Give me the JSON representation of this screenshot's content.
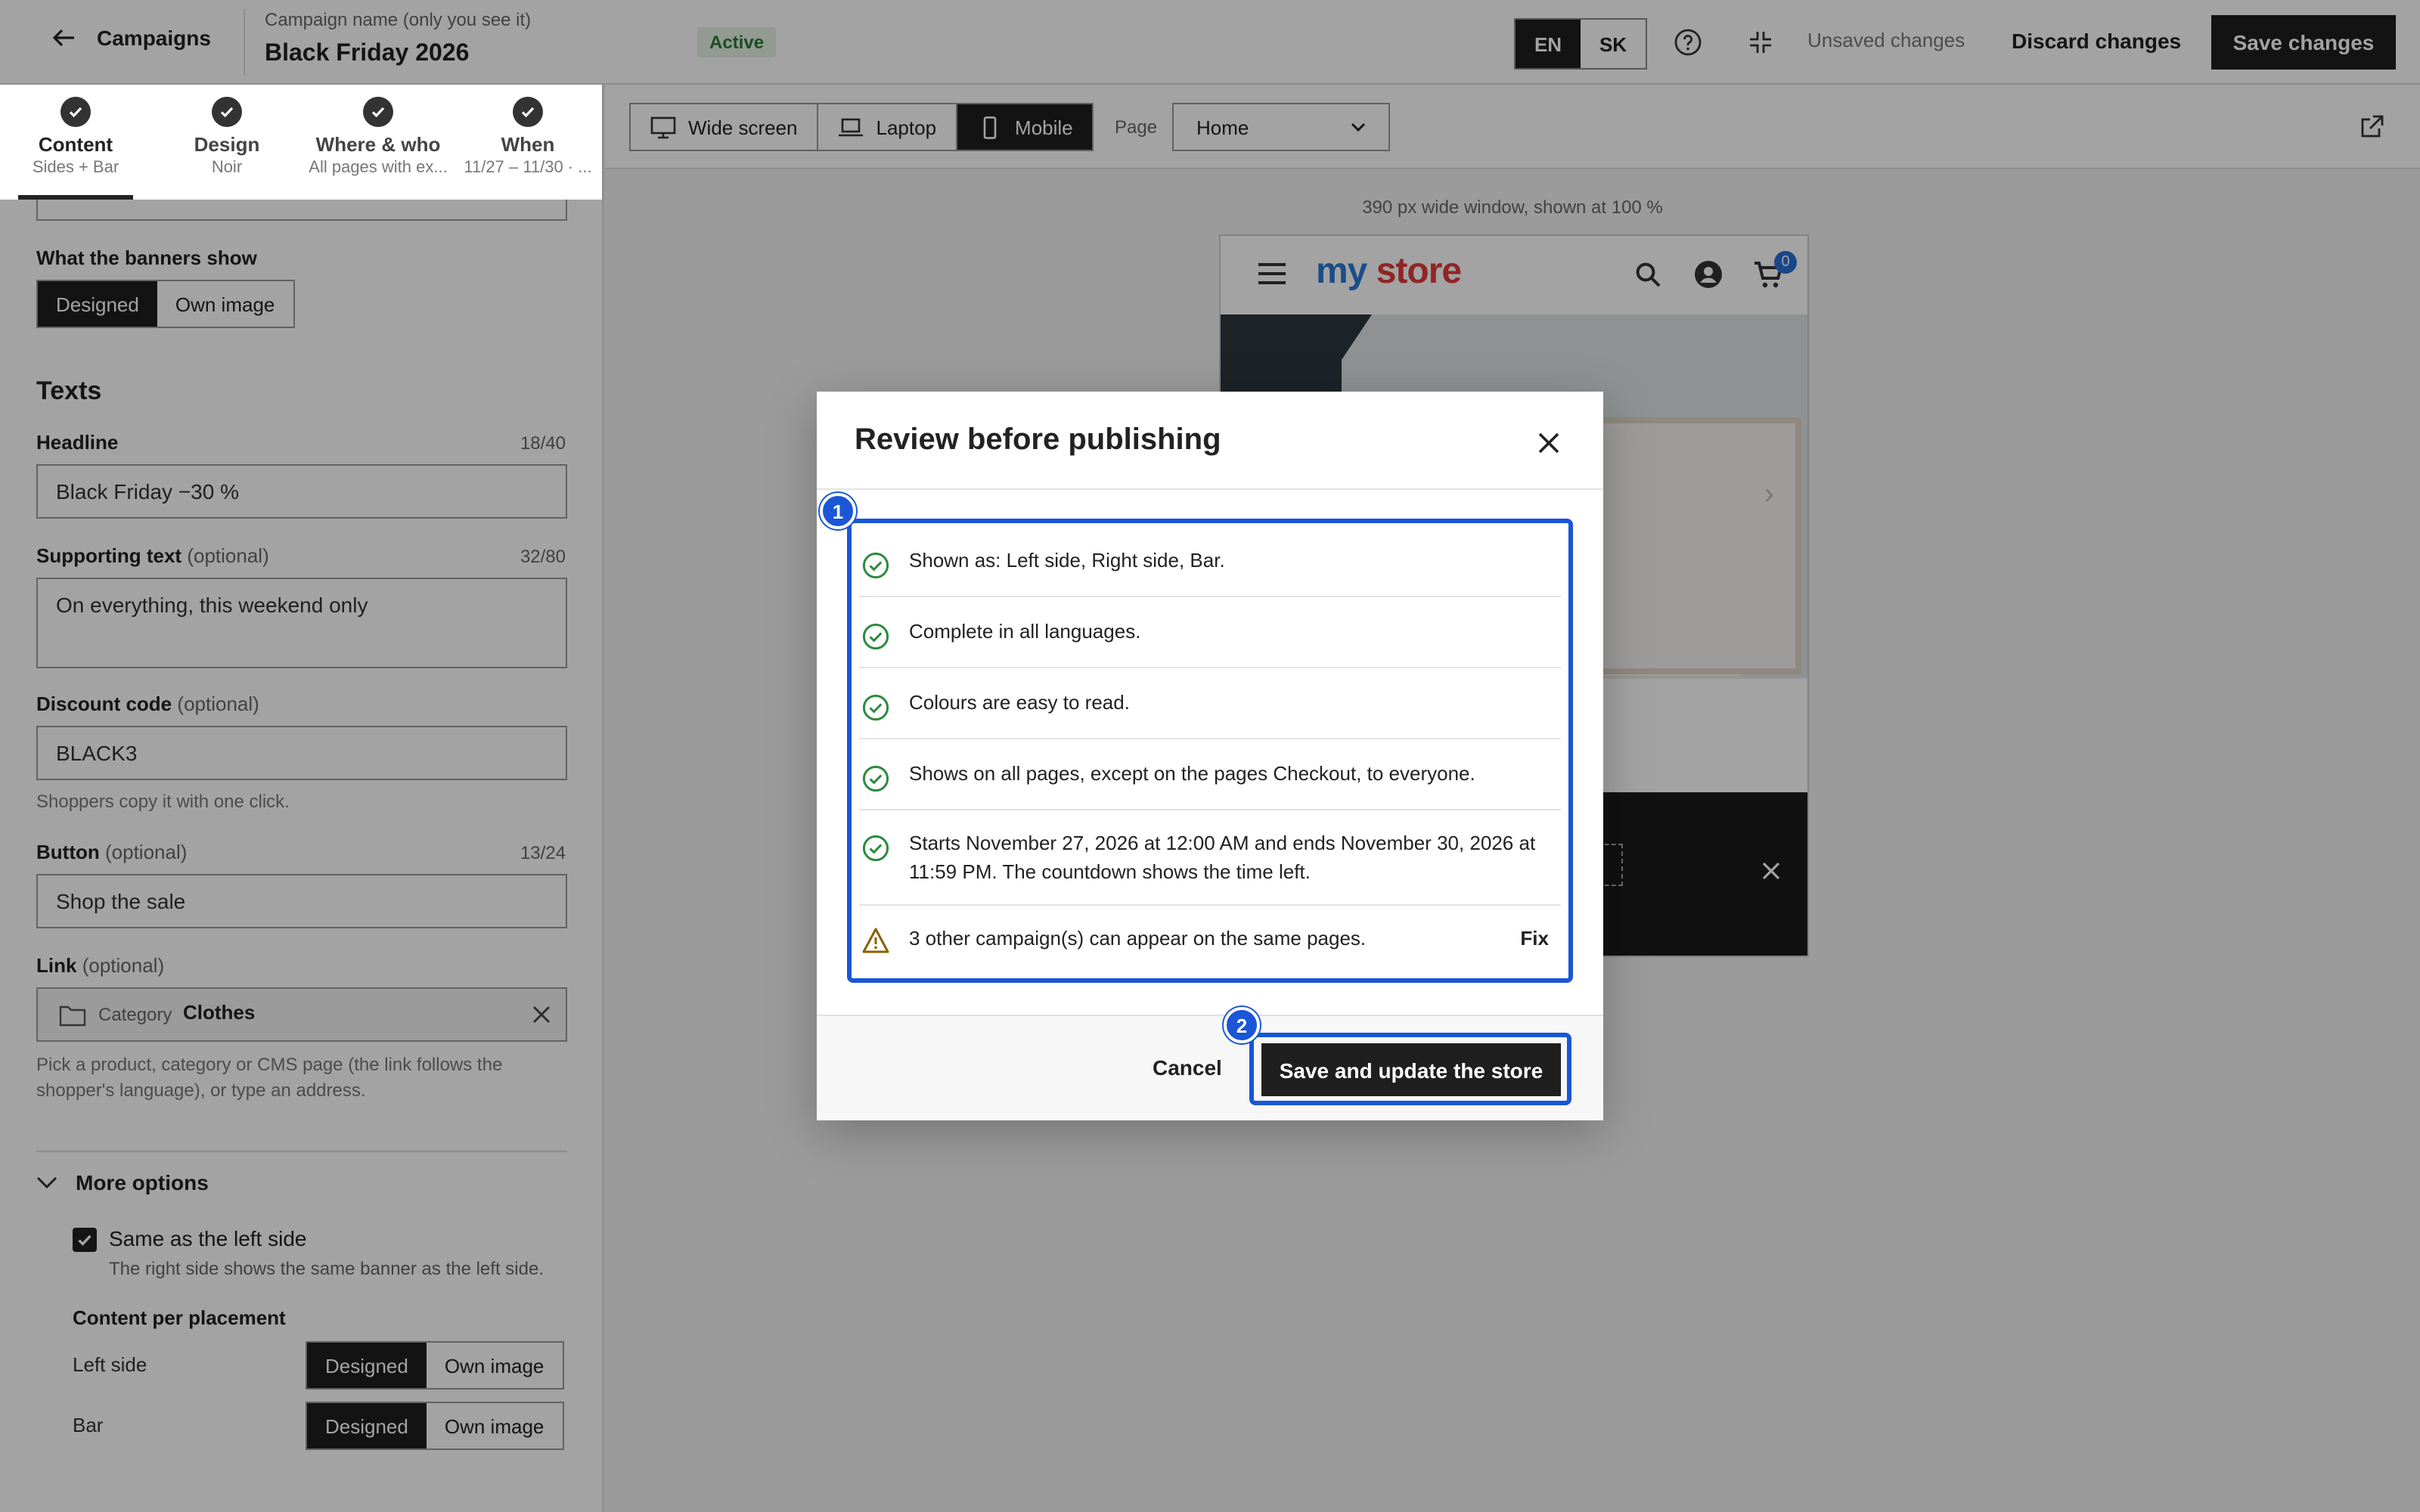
{
  "header": {
    "back_label": "Campaigns",
    "campaign_caption": "Campaign name (only you see it)",
    "campaign_name": "Black Friday 2026",
    "status": "Active",
    "languages": [
      "EN",
      "SK"
    ],
    "active_language": "EN",
    "unsaved_text": "Unsaved changes",
    "discard_label": "Discard changes",
    "save_label": "Save changes"
  },
  "steps": [
    {
      "title": "Content",
      "subtitle": "Sides + Bar"
    },
    {
      "title": "Design",
      "subtitle": "Noir"
    },
    {
      "title": "Where & who",
      "subtitle": "All pages with ex..."
    },
    {
      "title": "When",
      "subtitle": "11/27 – 11/30 · ..."
    }
  ],
  "content": {
    "banners_label": "What the banners show",
    "banners_options": [
      "Designed",
      "Own image"
    ],
    "texts_heading": "Texts",
    "headline": {
      "label": "Headline",
      "counter": "18/40",
      "value": "Black Friday −30 %"
    },
    "supporting": {
      "label": "Supporting text",
      "optional": "(optional)",
      "counter": "32/80",
      "value": "On everything, this weekend only"
    },
    "discount": {
      "label": "Discount code",
      "optional": "(optional)",
      "value": "BLACK3",
      "helper": "Shoppers copy it with one click."
    },
    "button": {
      "label": "Button",
      "optional": "(optional)",
      "counter": "13/24",
      "value": "Shop the sale"
    },
    "link": {
      "label": "Link",
      "optional": "(optional)",
      "type": "Category",
      "value": "Clothes",
      "helper": "Pick a product, category or CMS page (the link follows the shopper's language), or type an address."
    },
    "more_options": "More options",
    "same_as_left": {
      "label": "Same as the left side",
      "helper": "The right side shows the same banner as the left side.",
      "checked": true
    },
    "per_placement_label": "Content per placement",
    "placements": [
      {
        "name": "Left side",
        "options": [
          "Designed",
          "Own image"
        ],
        "selected": "Designed"
      },
      {
        "name": "Bar",
        "options": [
          "Designed",
          "Own image"
        ],
        "selected": "Designed"
      }
    ]
  },
  "preview": {
    "devices": [
      "Wide screen",
      "Laptop",
      "Mobile"
    ],
    "active_device": "Mobile",
    "page_label": "Page",
    "page_value": "Home",
    "caption": "390 px wide window, shown at 100 %",
    "store": {
      "logo_a": "my",
      "logo_b": "store",
      "cart_count": "0"
    }
  },
  "modal": {
    "title": "Review before publishing",
    "markers": [
      "1",
      "2"
    ],
    "items": [
      {
        "status": "ok",
        "text": "Shown as: Left side, Right side, Bar."
      },
      {
        "status": "ok",
        "text": "Complete in all languages."
      },
      {
        "status": "ok",
        "text": "Colours are easy to read."
      },
      {
        "status": "ok",
        "text": "Shows on all pages, except on the pages Checkout, to everyone."
      },
      {
        "status": "ok",
        "text": "Starts November 27, 2026 at 12:00 AM and ends November 30, 2026 at 11:59 PM. The countdown shows the time left."
      },
      {
        "status": "warning",
        "text": "3 other campaign(s) can appear on the same pages.",
        "action": "Fix"
      }
    ],
    "cancel_label": "Cancel",
    "confirm_label": "Save and update the store"
  },
  "colors": {
    "accent": "#1a56d6",
    "ok": "#2d8a3e",
    "warning": "#b07800",
    "dark": "#1f1f1f"
  }
}
